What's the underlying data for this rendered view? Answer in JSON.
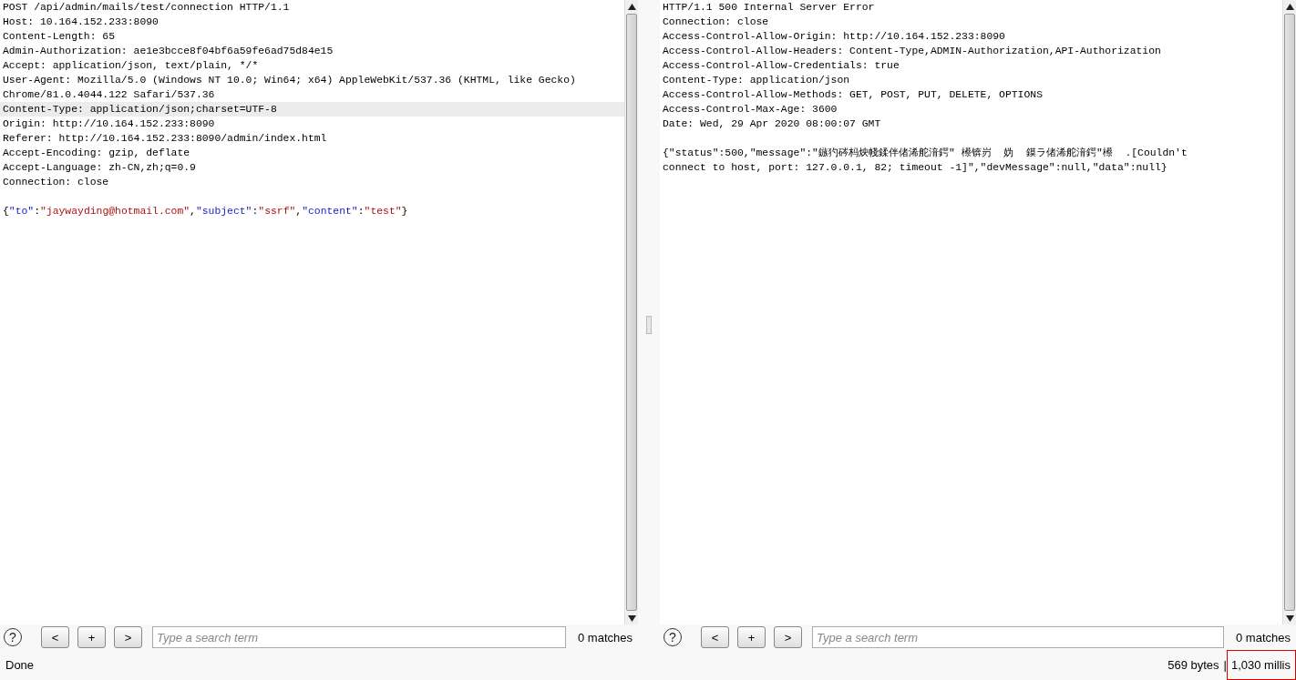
{
  "request": {
    "lines": [
      {
        "text": "POST /api/admin/mails/test/connection HTTP/1.1",
        "selected": false
      },
      {
        "text": "Host: 10.164.152.233:8090",
        "selected": false
      },
      {
        "text": "Content-Length: 65",
        "selected": false
      },
      {
        "text": "Admin-Authorization: ae1e3bcce8f04bf6a59fe6ad75d84e15",
        "selected": false
      },
      {
        "text": "Accept: application/json, text/plain, */*",
        "selected": false
      },
      {
        "text": "User-Agent: Mozilla/5.0 (Windows NT 10.0; Win64; x64) AppleWebKit/537.36 (KHTML, like Gecko)",
        "selected": false
      },
      {
        "text": "Chrome/81.0.4044.122 Safari/537.36",
        "selected": false
      },
      {
        "text": "Content-Type: application/json;charset=UTF-8",
        "selected": true
      },
      {
        "text": "Origin: http://10.164.152.233:8090",
        "selected": false
      },
      {
        "text": "Referer: http://10.164.152.233:8090/admin/index.html",
        "selected": false
      },
      {
        "text": "Accept-Encoding: gzip, deflate",
        "selected": false
      },
      {
        "text": "Accept-Language: zh-CN,zh;q=0.9",
        "selected": false
      },
      {
        "text": "Connection: close",
        "selected": false
      }
    ],
    "body": [
      {
        "kind": "punct",
        "text": "{"
      },
      {
        "kind": "key",
        "text": "\"to\""
      },
      {
        "kind": "punct",
        "text": ":"
      },
      {
        "kind": "value",
        "text": "\"jaywayding@hotmail.com\""
      },
      {
        "kind": "punct",
        "text": ","
      },
      {
        "kind": "key",
        "text": "\"subject\""
      },
      {
        "kind": "punct",
        "text": ":"
      },
      {
        "kind": "value",
        "text": "\"ssrf\""
      },
      {
        "kind": "punct",
        "text": ","
      },
      {
        "kind": "key",
        "text": "\"content\""
      },
      {
        "kind": "punct",
        "text": ":"
      },
      {
        "kind": "value",
        "text": "\"test\""
      },
      {
        "kind": "punct",
        "text": "}"
      }
    ],
    "search": {
      "help": "?",
      "buttons": [
        "<",
        "+",
        ">"
      ],
      "placeholder": "Type a search term",
      "matches": "0 matches"
    }
  },
  "response": {
    "lines": [
      {
        "text": "HTTP/1.1 500 Internal Server Error",
        "selected": false
      },
      {
        "text": "Connection: close",
        "selected": false
      },
      {
        "text": "Access-Control-Allow-Origin: http://10.164.152.233:8090",
        "selected": false
      },
      {
        "text": "Access-Control-Allow-Headers: Content-Type,ADMIN-Authorization,API-Authorization",
        "selected": false
      },
      {
        "text": "Access-Control-Allow-Credentials: true",
        "selected": false
      },
      {
        "text": "Content-Type: application/json",
        "selected": false
      },
      {
        "text": "Access-Control-Allow-Methods: GET, POST, PUT, DELETE, OPTIONS",
        "selected": false
      },
      {
        "text": "Access-Control-Max-Age: 3600",
        "selected": false
      },
      {
        "text": "Date: Wed, 29 Apr 2020 08:00:07 GMT",
        "selected": false
      }
    ],
    "body_lines": [
      "{\"status\":500,\"message\":\"鏃犳硶杩炴帴鍒伴偖浠舵湇鍔″ 櫒锛岃  妫  鏌ラ偖浠舵湇鍔″櫒  .[Couldn't",
      "connect to host, port: 127.0.0.1, 82; timeout -1]\",\"devMessage\":null,\"data\":null}"
    ],
    "search": {
      "help": "?",
      "buttons": [
        "<",
        "+",
        ">"
      ],
      "placeholder": "Type a search term",
      "matches": "0 matches"
    }
  },
  "status_bar": {
    "state": "Done",
    "size": "569 bytes",
    "separator": "|",
    "time": "1,030 millis",
    "time_highlighted": true
  }
}
